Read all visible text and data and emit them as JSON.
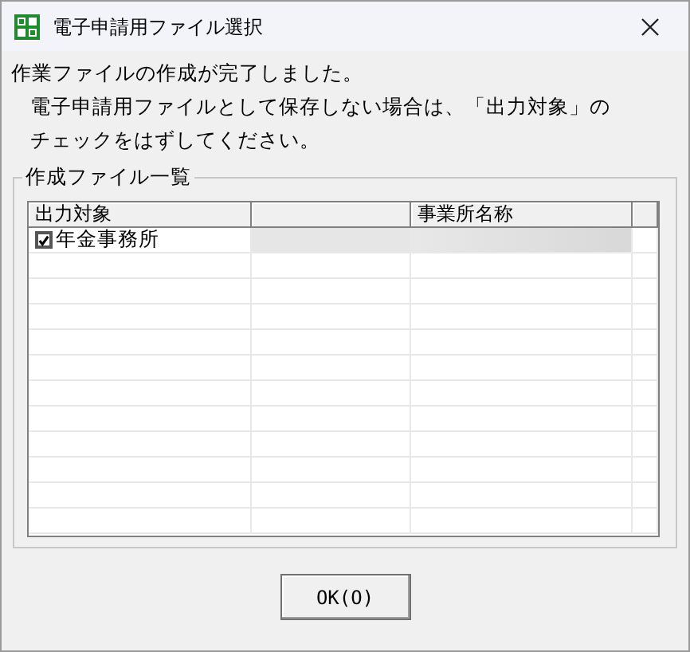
{
  "window": {
    "title": "電子申請用ファイル選択"
  },
  "message": [
    "作業ファイルの作成が完了しました。",
    "電子申請用ファイルとして保存しない場合は、「出力対象」の",
    "チェックをはずしてください。"
  ],
  "group": {
    "title": "作成ファイル一覧"
  },
  "table": {
    "columns": [
      {
        "label": "出力対象"
      },
      {
        "label": "事業所名称"
      }
    ],
    "rows": [
      {
        "label": "年金事務所",
        "checked": true,
        "selected": true
      }
    ]
  },
  "buttons": [
    {
      "label": "OK(O)"
    }
  ]
}
